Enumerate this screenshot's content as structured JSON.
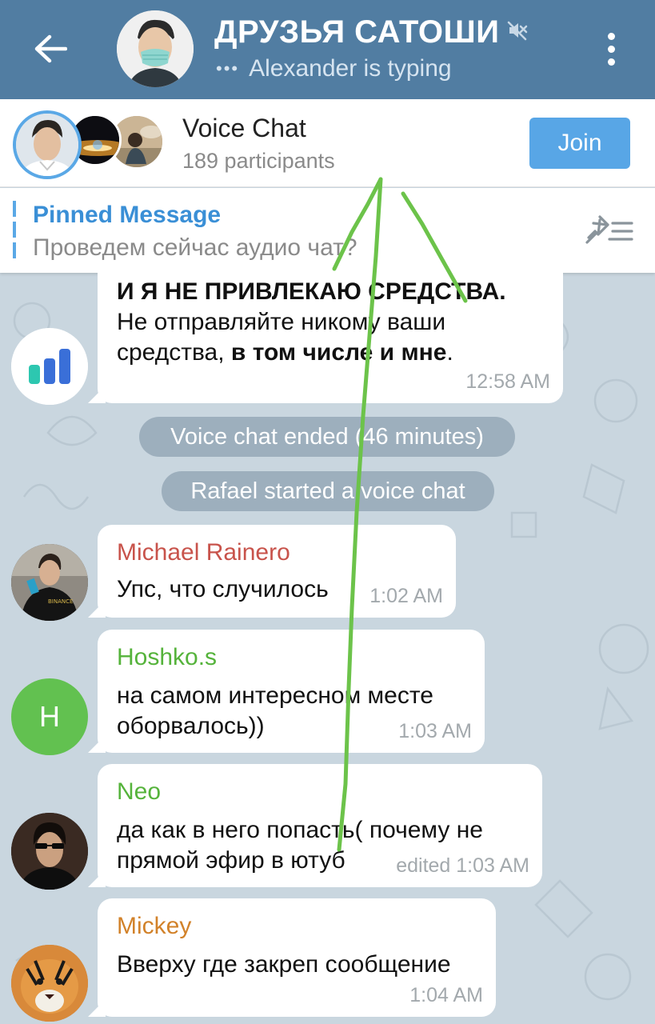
{
  "header": {
    "title": "ДРУЗЬЯ САТОШИ",
    "typing_dots": "•••",
    "typing_text": "Alexander is typing",
    "muted_icon": "muted-speaker-icon"
  },
  "voice_chat": {
    "title": "Voice Chat",
    "participants": "189 participants",
    "join_label": "Join"
  },
  "pinned": {
    "title": "Pinned Message",
    "text": "Проведем сейчас аудио чат?"
  },
  "messages": [
    {
      "lines_html": [
        "И Я НЕ ПРИВЛЕКАЮ СРЕДСТВА.",
        "Не отправляйте никому ваши",
        "средства, ",
        "в том числе и мне",
        "."
      ],
      "line1": "И Я НЕ ПРИВЛЕКАЮ СРЕДСТВА.",
      "line2": "Не отправляйте никому ваши",
      "line3a": "средства, ",
      "line3b": "в том числе и мне",
      "line3c": ".",
      "time": "12:58 AM"
    },
    {
      "sender": "Michael Rainero",
      "text": "Упс, что случилось",
      "time": "1:02 AM"
    },
    {
      "sender": "Hoshko.s",
      "avatar_letter": "H",
      "line1": "на самом интересном месте",
      "line2": "оборвалось))",
      "time": "1:03 AM"
    },
    {
      "sender": "Neo",
      "line1": "да как в него попасть( почему не",
      "line2": "прямой эфир в ютуб",
      "time": "edited 1:03 AM"
    },
    {
      "sender": "Mickey",
      "text": "Вверху где закреп сообщение",
      "time": "1:04 AM"
    }
  ],
  "service": [
    {
      "text": "Voice chat ended (46 minutes)"
    },
    {
      "text": "Rafael started a voice chat"
    }
  ],
  "colors": {
    "header_bg": "#517da2",
    "join_bg": "#58a6e6",
    "michael": "#c8534b",
    "hoshko": "#55b33b",
    "neo": "#55b33b",
    "mickey": "#d2822a",
    "hoshko_avatar": "#62c150",
    "annotation_stroke": "#6cc34a"
  }
}
